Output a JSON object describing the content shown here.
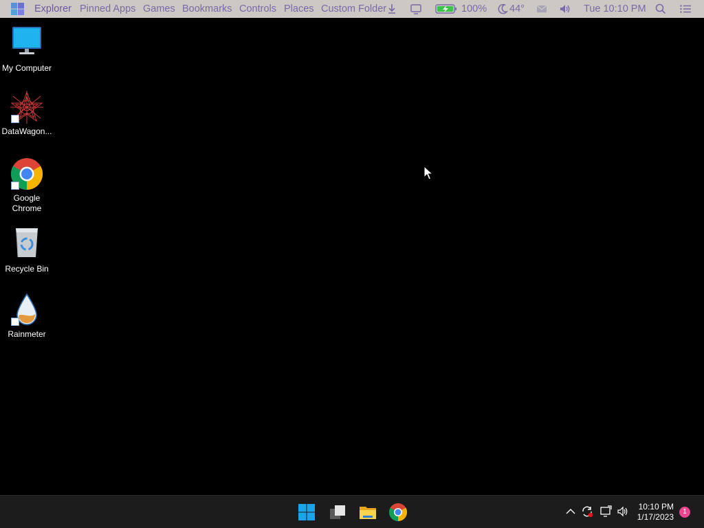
{
  "menubar": {
    "items": [
      "Explorer",
      "Pinned Apps",
      "Games",
      "Bookmarks",
      "Controls",
      "Places",
      "Custom Folder"
    ],
    "battery": "100%",
    "weather": "44°",
    "datetime": "Tue 10:10 PM",
    "text_color": "#7b68a8",
    "background": "#ccc9c4"
  },
  "desktop": {
    "icons": [
      {
        "label": "My Computer",
        "icon": "monitor-icon"
      },
      {
        "label": "DataWagon...",
        "icon": "datawagon-icon"
      },
      {
        "label": "Google Chrome",
        "icon": "chrome-icon"
      },
      {
        "label": "Recycle Bin",
        "icon": "recycle-bin-icon"
      },
      {
        "label": "Rainmeter",
        "icon": "rainmeter-icon"
      }
    ]
  },
  "taskbar": {
    "pinned": [
      "windows-start-icon",
      "task-view-icon",
      "file-explorer-icon",
      "chrome-icon"
    ],
    "clock_time": "10:10 PM",
    "clock_date": "1/17/2023",
    "notification_count": "1",
    "background": "#1c1c1c"
  }
}
